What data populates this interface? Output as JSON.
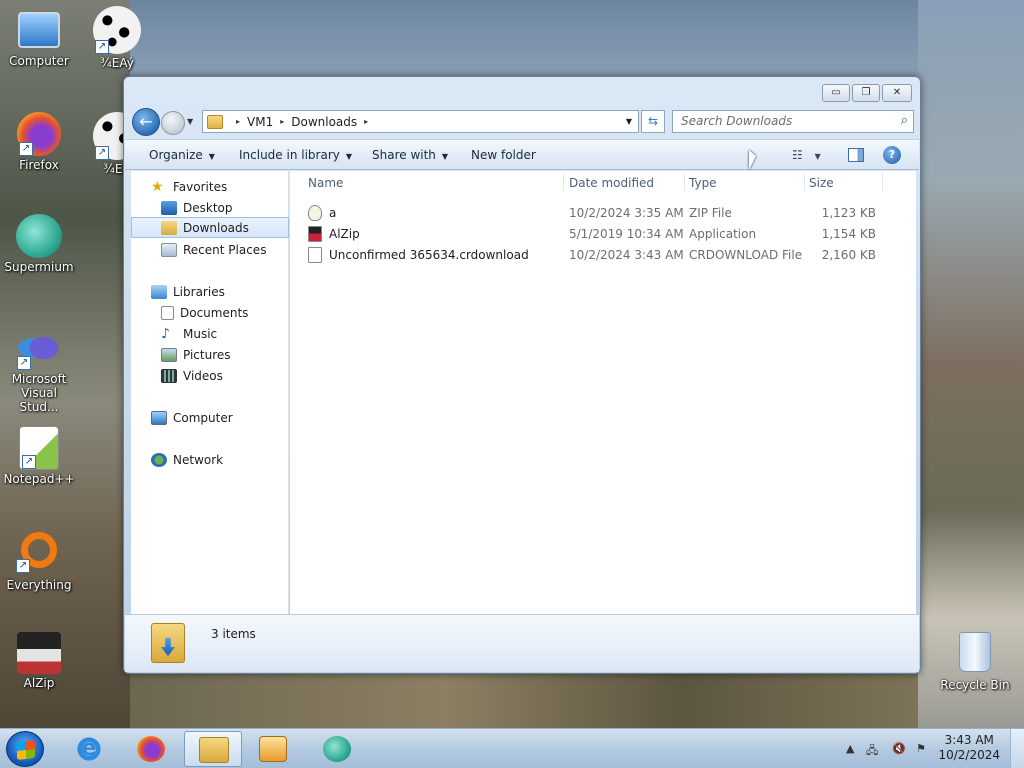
{
  "desktop": {
    "icons": [
      {
        "label": "Computer",
        "icon": "computer-icon"
      },
      {
        "label": "¾EAý",
        "icon": "media-icon"
      },
      {
        "label": "Firefox",
        "icon": "firefox-icon"
      },
      {
        "label": "¾EA",
        "icon": "media-icon"
      },
      {
        "label": "Supermium",
        "icon": "supermium-icon"
      },
      {
        "label": "Microsoft Visual Stud...",
        "icon": "visual-studio-icon"
      },
      {
        "label": "Notepad++",
        "icon": "notepadpp-icon"
      },
      {
        "label": "Everything",
        "icon": "everything-icon"
      },
      {
        "label": "AlZip",
        "icon": "alzip-icon"
      },
      {
        "label": "Recycle Bin",
        "icon": "recycle-bin-icon"
      }
    ]
  },
  "window": {
    "caption_buttons": {
      "minimize": "▭",
      "maximize": "❐",
      "close": "✕"
    },
    "address": {
      "segments": [
        "VM1",
        "Downloads"
      ],
      "separator": "▸"
    },
    "search": {
      "placeholder": "Search Downloads"
    },
    "commands": {
      "organize": "Organize",
      "include_in_library": "Include in library",
      "share_with": "Share with",
      "new_folder": "New folder"
    },
    "nav_pane": {
      "favorites": {
        "label": "Favorites",
        "items": [
          "Desktop",
          "Downloads",
          "Recent Places"
        ]
      },
      "libraries": {
        "label": "Libraries",
        "items": [
          "Documents",
          "Music",
          "Pictures",
          "Videos"
        ]
      },
      "computer": "Computer",
      "network": "Network",
      "selected": "Downloads"
    },
    "columns": {
      "name": "Name",
      "date_modified": "Date modified",
      "type": "Type",
      "size": "Size"
    },
    "files": [
      {
        "name": "a",
        "date": "10/2/2024 3:35 AM",
        "type": "ZIP File",
        "size": "1,123 KB",
        "icon": "zip-file-icon"
      },
      {
        "name": "AlZip",
        "date": "5/1/2019 10:34 AM",
        "type": "Application",
        "size": "1,154 KB",
        "icon": "alzip-app-icon"
      },
      {
        "name": "Unconfirmed 365634.crdownload",
        "date": "10/2/2024 3:43 AM",
        "type": "CRDOWNLOAD File",
        "size": "2,160 KB",
        "icon": "blank-file-icon"
      }
    ],
    "details": {
      "item_count": "3 items"
    }
  },
  "taskbar": {
    "clock": {
      "time": "3:43 AM",
      "date": "10/2/2024"
    },
    "pinned": [
      "internet-explorer-icon",
      "firefox-icon",
      "file-explorer-icon",
      "media-player-icon",
      "supermium-icon"
    ],
    "active": "file-explorer-icon"
  }
}
